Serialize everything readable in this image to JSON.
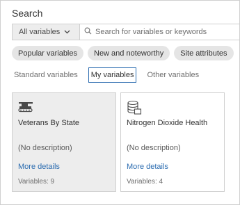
{
  "panel": {
    "title": "Search"
  },
  "search": {
    "scope_value": "All variables",
    "placeholder": "Search for variables or keywords",
    "value": ""
  },
  "chips": [
    {
      "label": "Popular variables"
    },
    {
      "label": "New and noteworthy"
    },
    {
      "label": "Site attributes"
    }
  ],
  "tabs": [
    {
      "label": "Standard variables",
      "active": false
    },
    {
      "label": "My variables",
      "active": true
    },
    {
      "label": "Other variables",
      "active": false
    }
  ],
  "cards": [
    {
      "icon": "tank-icon",
      "name": "Veterans By State",
      "description": "(No description)",
      "link": "More details",
      "count": "Variables: 9",
      "selected": true
    },
    {
      "icon": "database-icon",
      "name": "Nitrogen Dioxide Health",
      "description": "(No description)",
      "link": "More details",
      "count": "Variables: 4",
      "selected": false
    }
  ],
  "colors": {
    "accent": "#2b6cb0",
    "chip_bg": "#e5e5e5",
    "selected_card_bg": "#ededed"
  }
}
